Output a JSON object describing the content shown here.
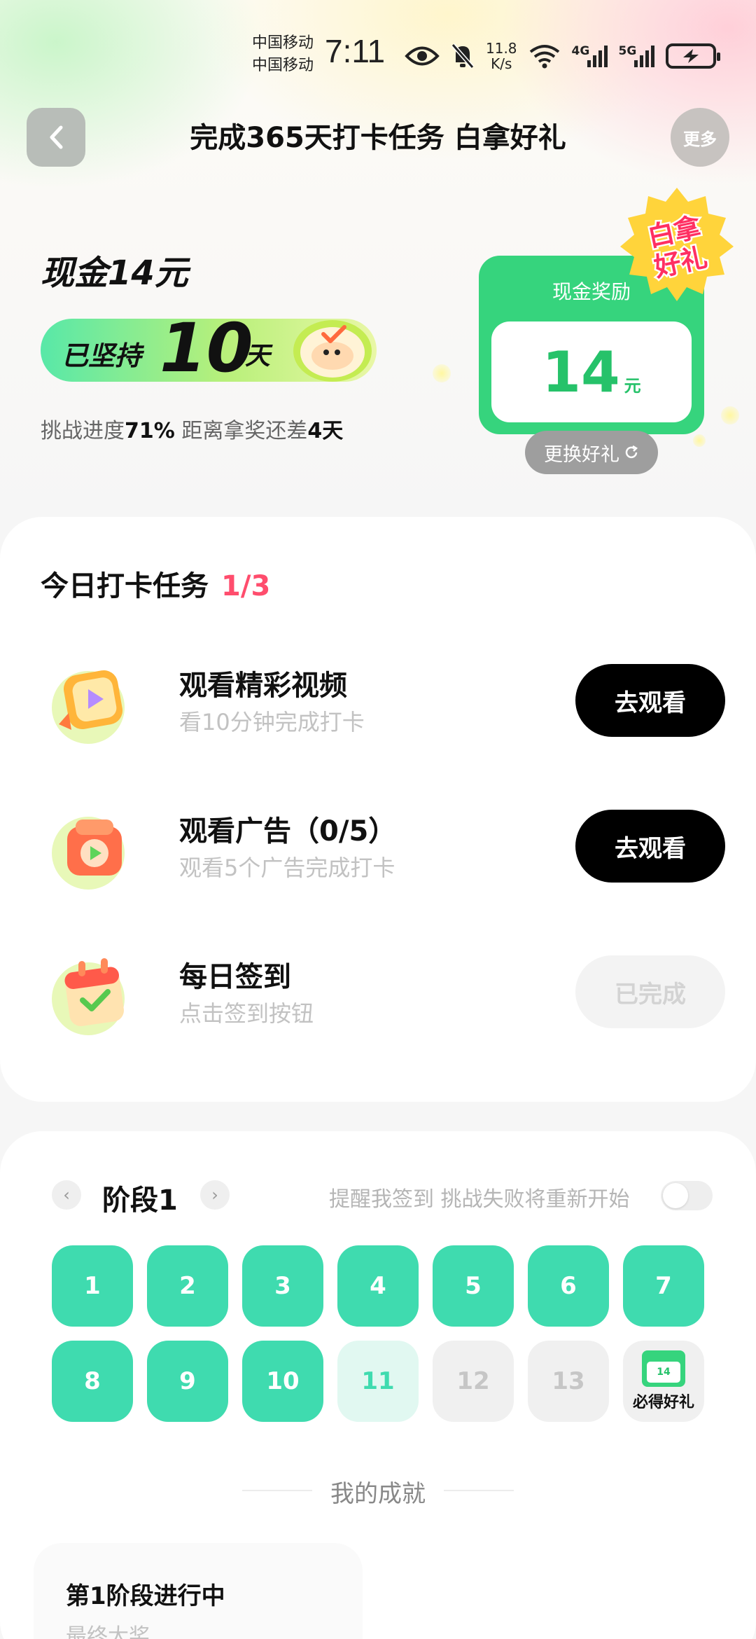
{
  "status_bar": {
    "carrier1": "中国移动",
    "carrier2": "中国移动",
    "time": "7:11",
    "net_speed_value": "11.8",
    "net_speed_unit": "K/s",
    "sim1": "4G",
    "sim2": "5G",
    "icons": [
      "eye-icon",
      "mute-bell-icon",
      "wifi-icon",
      "signal-icon",
      "signal-icon",
      "battery-charging-icon"
    ]
  },
  "header": {
    "title": "完成365天打卡任务 白拿好礼",
    "more_label": "更多"
  },
  "hero": {
    "cash_title": "现金14元",
    "streak_prefix": "已坚持",
    "streak_days": "10",
    "streak_suffix": "天",
    "progress_label": "挑战进度",
    "progress_value": "71%",
    "remaining_label": " 距离拿奖还差",
    "remaining_value": "4天"
  },
  "reward": {
    "label": "现金奖励",
    "amount": "14",
    "unit": "元",
    "badge_line1": "白拿",
    "badge_line2": "好礼",
    "swap_label": "更换好礼",
    "accent_color": "#36d47d"
  },
  "tasks": {
    "title": "今日打卡任务",
    "count": "1/3",
    "items": [
      {
        "name": "观看精彩视频",
        "sub": "看10分钟完成打卡",
        "button": "去观看",
        "done": false
      },
      {
        "name": "观看广告（0/5）",
        "sub": "观看5个广告完成打卡",
        "button": "去观看",
        "done": false
      },
      {
        "name": "每日签到",
        "sub": "点击签到按钮",
        "button": "已完成",
        "done": true
      }
    ]
  },
  "stage": {
    "prev": "‹",
    "next": "›",
    "title": "阶段1",
    "remind_text": "提醒我签到 挑战失败将重新开始",
    "remind_enabled": false,
    "days": [
      {
        "label": "1",
        "state": "done"
      },
      {
        "label": "2",
        "state": "done"
      },
      {
        "label": "3",
        "state": "done"
      },
      {
        "label": "4",
        "state": "done"
      },
      {
        "label": "5",
        "state": "done"
      },
      {
        "label": "6",
        "state": "done"
      },
      {
        "label": "7",
        "state": "done"
      },
      {
        "label": "8",
        "state": "done"
      },
      {
        "label": "9",
        "state": "done"
      },
      {
        "label": "10",
        "state": "done"
      },
      {
        "label": "11",
        "state": "today"
      },
      {
        "label": "12",
        "state": "future"
      },
      {
        "label": "13",
        "state": "future"
      }
    ],
    "gift_label": "必得好礼",
    "done_color": "#3fdbaf"
  },
  "achievements": {
    "title": "我的成就",
    "card_title": "第1阶段进行中",
    "card_sub": "最终大奖"
  }
}
